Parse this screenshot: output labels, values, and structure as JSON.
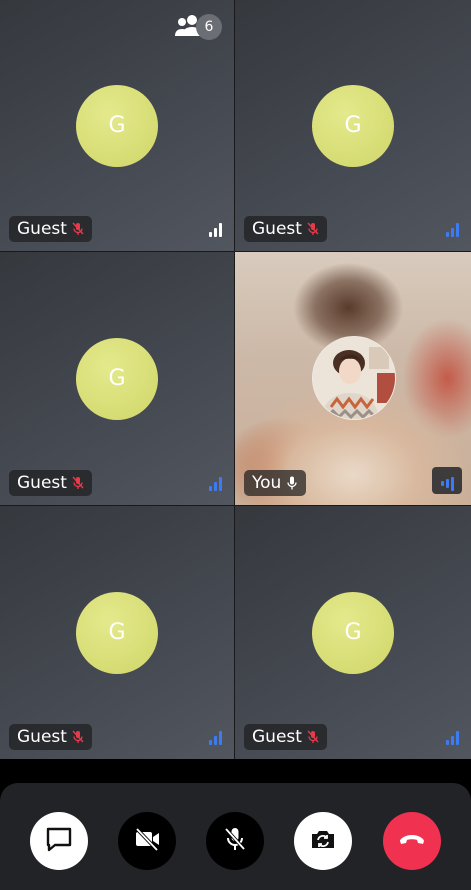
{
  "participants": {
    "count": "6",
    "icon": "participants-icon"
  },
  "tiles": [
    {
      "name": "Guest",
      "initial": "G",
      "mic": "muted",
      "signal": "white"
    },
    {
      "name": "Guest",
      "initial": "G",
      "mic": "muted",
      "signal": "blue"
    },
    {
      "name": "Guest",
      "initial": "G",
      "mic": "muted",
      "signal": "blue"
    },
    {
      "name": "You",
      "mic": "on",
      "signal": "blue"
    },
    {
      "name": "Guest",
      "initial": "G",
      "mic": "muted",
      "signal": "blue"
    },
    {
      "name": "Guest",
      "initial": "G",
      "mic": "muted",
      "signal": "blue"
    }
  ],
  "controls": [
    {
      "icon": "chat-icon"
    },
    {
      "icon": "camera-off-icon"
    },
    {
      "icon": "mic-off-icon"
    },
    {
      "icon": "switch-camera-icon"
    },
    {
      "icon": "end-call-icon"
    }
  ],
  "colors": {
    "avatar": "#d8de78",
    "muted_mic": "#e83a4a",
    "signal_blue": "#3b7cf5",
    "end_call": "#f0314f"
  }
}
